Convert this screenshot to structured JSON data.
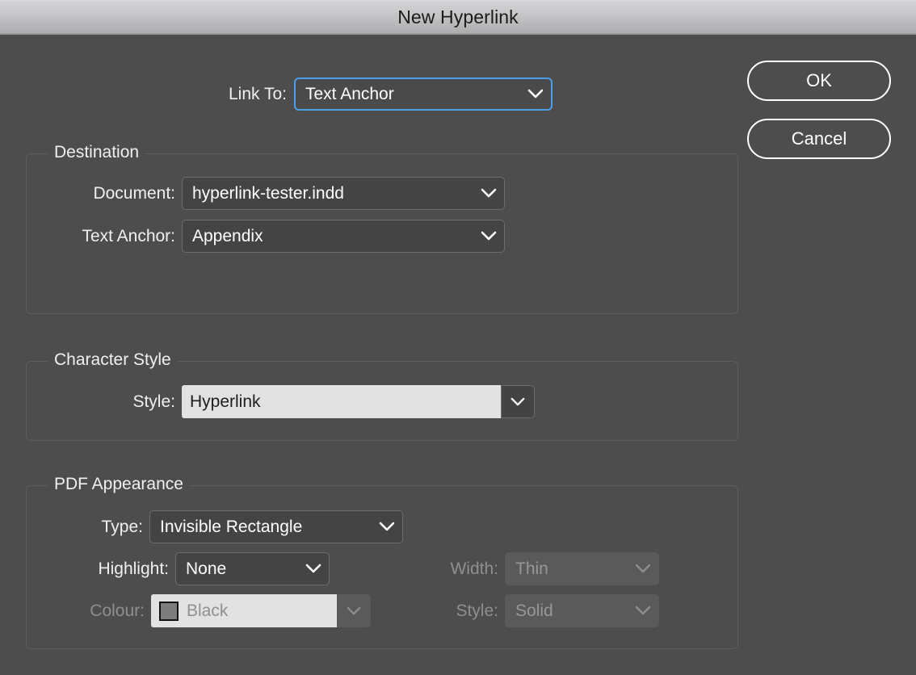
{
  "window": {
    "title": "New Hyperlink"
  },
  "buttons": {
    "ok": "OK",
    "cancel": "Cancel"
  },
  "link_to": {
    "label": "Link To:",
    "value": "Text Anchor",
    "icon": "chevron-down-icon"
  },
  "destination": {
    "title": "Destination",
    "document": {
      "label": "Document:",
      "value": "hyperlink-tester.indd"
    },
    "text_anchor": {
      "label": "Text Anchor:",
      "value": "Appendix"
    }
  },
  "character_style": {
    "title": "Character Style",
    "style": {
      "label": "Style:",
      "value": "Hyperlink"
    }
  },
  "pdf_appearance": {
    "title": "PDF Appearance",
    "type": {
      "label": "Type:",
      "value": "Invisible Rectangle"
    },
    "highlight": {
      "label": "Highlight:",
      "value": "None"
    },
    "colour": {
      "label": "Colour:",
      "value": "Black",
      "swatch": "#7d7d7d"
    },
    "width": {
      "label": "Width:",
      "value": "Thin"
    },
    "style": {
      "label": "Style:",
      "value": "Solid"
    }
  },
  "colors": {
    "dialog_bg": "#4d4d4d",
    "titlebar": "#c6c6c8",
    "focus_ring": "#4a9eea",
    "field_light": "#e2e2e2",
    "field_dark": "#444444",
    "disabled_text": "#909090"
  }
}
